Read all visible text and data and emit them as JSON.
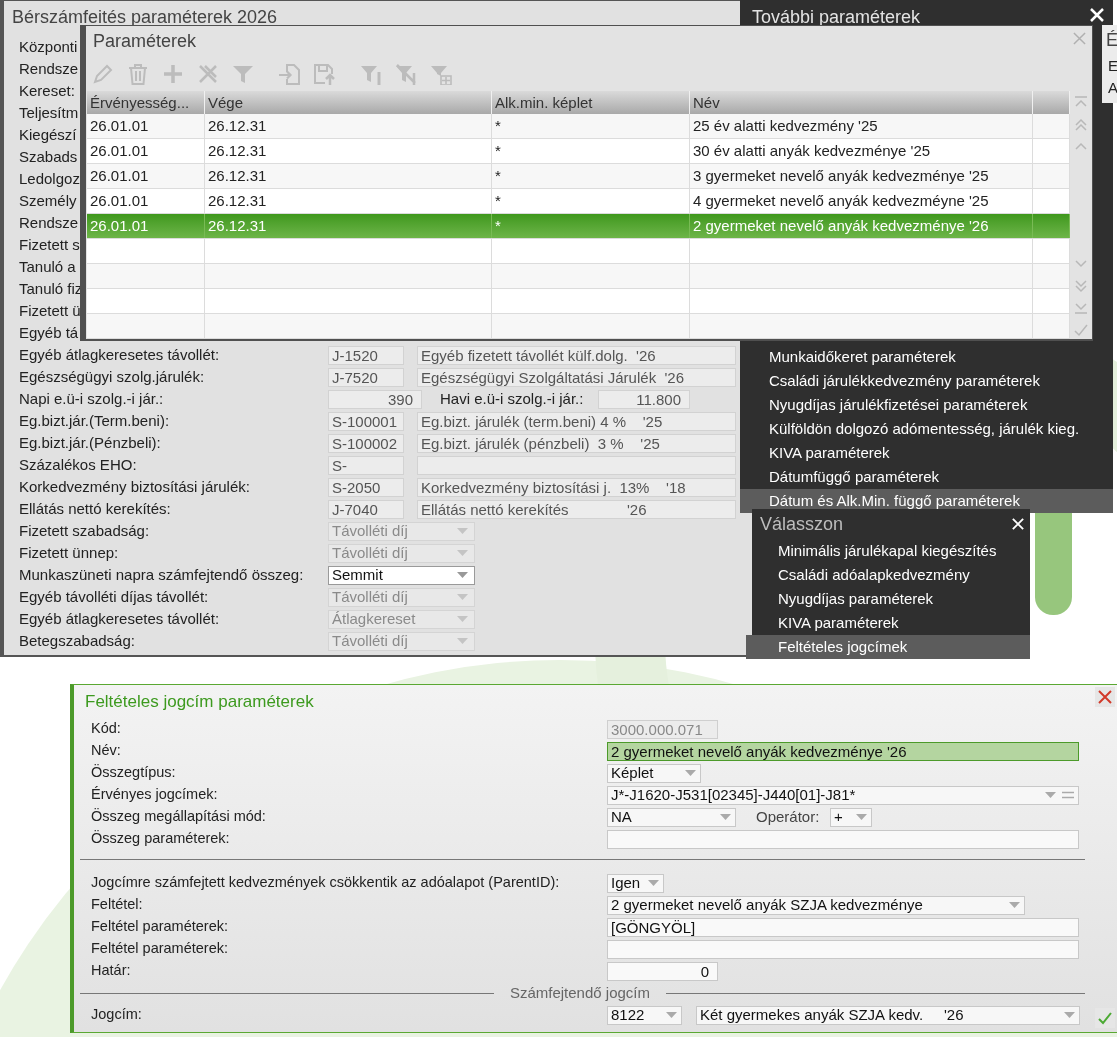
{
  "main_window": {
    "title": "Bérszámfeités paraméterek 2026",
    "rows": [
      {
        "kind": "label",
        "label": "Központi"
      },
      {
        "kind": "label",
        "label": "Rendsze"
      },
      {
        "kind": "label",
        "label": "Kereset:"
      },
      {
        "kind": "label",
        "label": "Teljesítm"
      },
      {
        "kind": "label",
        "label": "Kiegészí"
      },
      {
        "kind": "label",
        "label": "Szabads"
      },
      {
        "kind": "label",
        "label": "Ledolgoz"
      },
      {
        "kind": "label",
        "label": "Személy"
      },
      {
        "kind": "label",
        "label": "Rendsze"
      },
      {
        "kind": "label",
        "label": "Fizetett s"
      },
      {
        "kind": "label",
        "label": "Tanuló a"
      },
      {
        "kind": "label",
        "label": "Tanuló fiz"
      },
      {
        "kind": "label",
        "label": "Fizetett ü"
      },
      {
        "kind": "label",
        "label": "Egyéb tá"
      },
      {
        "kind": "code",
        "label": "Egyéb átlagkeresetes távollét:",
        "code": "J-1520",
        "description": "Egyéb fizetett távollét külf.dolg.  '26"
      },
      {
        "kind": "code",
        "label": "Egészségügyi szolg.járulék:",
        "code": "J-7520",
        "description": "Egészségügyi Szolgáltatási Járulék  '26"
      },
      {
        "kind": "amount",
        "label": "Napi e.ü-i szolg.-i jár.:",
        "value": "390",
        "second_label": "Havi e.ü-i szolg.-i jár.:",
        "second_value": "11.800"
      },
      {
        "kind": "code",
        "label": "Eg.bizt.jár.(Term.beni):",
        "code": "S-100001",
        "description": "Eg.bizt. járulék (term.beni) 4 %    '25"
      },
      {
        "kind": "code",
        "label": "Eg.bizt.jár.(Pénzbeli):",
        "code": "S-100002",
        "description": "Eg.bizt. járulék (pénzbeli)  3 %    '25"
      },
      {
        "kind": "code",
        "label": "Százalékos EHO:",
        "code": "S-"
      },
      {
        "kind": "code",
        "label": "Korkedvezmény biztosítási járulék:",
        "code": "S-2050",
        "description": "Korkedvezmény biztosítási j.  13%    '18"
      },
      {
        "kind": "code",
        "label": "Ellátás nettó kerekítés:",
        "code": "J-7040",
        "description": "Ellátás nettó kerekítés              '26"
      },
      {
        "kind": "select",
        "label": "Fizetett szabadság:",
        "value": "Távolléti díj",
        "disabled": true
      },
      {
        "kind": "select",
        "label": "Fizetett ünnep:",
        "value": "Távolléti díj",
        "disabled": true
      },
      {
        "kind": "select",
        "label": "Munkaszüneti napra számfejtendő összeg:",
        "value": "Semmit",
        "disabled": false
      },
      {
        "kind": "select",
        "label": "Egyéb távolléti díjas távollét:",
        "value": "Távolléti díj",
        "disabled": true
      },
      {
        "kind": "select",
        "label": "Egyéb átlagkeresetes távollét:",
        "value": "Átlagkereset",
        "disabled": true
      },
      {
        "kind": "select",
        "label": "Betegszabadság:",
        "value": "Távolléti díj",
        "disabled": true
      }
    ]
  },
  "more_menu": {
    "title": "További paraméterek",
    "items": [
      {
        "label": "Munkaidőkeret paraméterek",
        "selected": false
      },
      {
        "label": "Családi járulékkedvezmény paraméterek",
        "selected": false
      },
      {
        "label": "Nyugdíjas járulékfizetései paraméterek",
        "selected": false
      },
      {
        "label": "Külföldön dolgozó adómentesség, járulék kieg.",
        "selected": false
      },
      {
        "label": "KIVA paraméterek",
        "selected": false
      },
      {
        "label": "Dátumfüggő paraméterek",
        "selected": false
      },
      {
        "label": "Dátum és Alk.Min. függő paraméterek",
        "selected": true
      }
    ]
  },
  "side_window": {
    "title": "É",
    "rows": [
      "E",
      "A"
    ]
  },
  "parameters_window": {
    "title": "Paraméterek",
    "toolbar": [
      {
        "kind": "pencil",
        "disabled": true
      },
      {
        "kind": "trash",
        "disabled": true
      },
      {
        "kind": "plus",
        "disabled": true
      },
      {
        "kind": "unpin",
        "disabled": true
      },
      {
        "kind": "filter",
        "disabled": true
      },
      {
        "kind": "import",
        "disabled": true
      },
      {
        "kind": "upload",
        "disabled": true
      },
      {
        "kind": "filter_column",
        "disabled": true
      },
      {
        "kind": "filter_clear",
        "disabled": true
      },
      {
        "kind": "filter_add",
        "disabled": true
      }
    ],
    "table": {
      "columns": [
        "Érvényesség...",
        "Vége",
        "Alk.min. képlet",
        "Név"
      ],
      "rows": [
        {
          "cells": [
            "26.01.01",
            "26.12.31",
            "*",
            "25 év alatti kedvezmény '25"
          ],
          "selected": false
        },
        {
          "cells": [
            "26.01.01",
            "26.12.31",
            "*",
            "30 év alatti anyák kedvezménye '25"
          ],
          "selected": false
        },
        {
          "cells": [
            "26.01.01",
            "26.12.31",
            "*",
            "3 gyermeket nevelő anyák kedvezménye '25"
          ],
          "selected": false
        },
        {
          "cells": [
            "26.01.01",
            "26.12.31",
            "*",
            "4 gyermeket nevelő anyák kedvezméyne '25"
          ],
          "selected": false
        },
        {
          "cells": [
            "26.01.01",
            "26.12.31",
            "*",
            "2 gyermeket nevelő anyák kedvezménye '26"
          ],
          "selected": true
        }
      ]
    }
  },
  "choose_popup": {
    "title": "Válasszon",
    "items": [
      {
        "label": "Minimális járulékapal kiegészítés",
        "selected": false
      },
      {
        "label": "Családi adóalapkedvezmény",
        "selected": false
      },
      {
        "label": "Nyugdíjas paraméterek",
        "selected": false
      },
      {
        "label": "KIVA paraméterek",
        "selected": false
      },
      {
        "label": "Feltételes jogcímek",
        "selected": true
      }
    ]
  },
  "condition_form": {
    "title": "Feltételes jogcím paraméterek",
    "sections": [
      {
        "rows": [
          {
            "label": "Kód:",
            "fields": [
              {
                "kind": "input",
                "value": "3000.000.071",
                "readonly": true,
                "focused": false
              }
            ]
          },
          {
            "label": "Név:",
            "fields": [
              {
                "kind": "input",
                "value": "2 gyermeket nevelő anyák kedvezménye '26",
                "readonly": false,
                "focused": true
              }
            ]
          },
          {
            "label": "Összegtípus:",
            "fields": [
              {
                "kind": "select",
                "value": "Képlet"
              }
            ]
          },
          {
            "label": "Érvényes jogcímek:",
            "fields": [
              {
                "kind": "list",
                "value": "J*-J1620-J531[02345]-J440[01]-J81*"
              }
            ]
          },
          {
            "label": "Összeg megállapítási mód:",
            "fields": [
              {
                "kind": "select",
                "value": "NA"
              },
              {
                "kind": "label",
                "value": "Operátor:"
              },
              {
                "kind": "select",
                "value": "+"
              }
            ]
          },
          {
            "label": "Összeg paraméterek:",
            "fields": [
              {
                "kind": "input",
                "readonly": false,
                "focused": false
              }
            ]
          }
        ]
      },
      {
        "rows": [
          {
            "label": "Jogcímre számfejtett kedvezmények csökkentik az adóalapot (ParentID):",
            "fields": [
              {
                "kind": "select",
                "value": "Igen"
              }
            ]
          },
          {
            "label": "Feltétel:",
            "fields": [
              {
                "kind": "select",
                "value": "2 gyermeket nevelő anyák SZJA kedvezménye"
              }
            ]
          },
          {
            "label": "Feltétel paraméterek:",
            "fields": [
              {
                "kind": "input",
                "value": "[GÖNGYÖL]",
                "readonly": false,
                "focused": false
              }
            ]
          },
          {
            "label": "Feltétel paraméterek:",
            "fields": [
              {
                "kind": "input",
                "readonly": false,
                "focused": false
              }
            ]
          },
          {
            "label": "Határ:",
            "fields": [
              {
                "kind": "number",
                "value": "0",
                "readonly": false,
                "focused": false
              }
            ]
          }
        ]
      },
      {
        "heading": "Számfejtendő jogcím",
        "rows": [
          {
            "label": "Jogcím:",
            "fields": [
              {
                "kind": "select",
                "value": "8122"
              },
              {
                "kind": "select",
                "value": "Két gyermekes anyák SZJA kedv.     '26"
              }
            ]
          }
        ]
      }
    ]
  }
}
